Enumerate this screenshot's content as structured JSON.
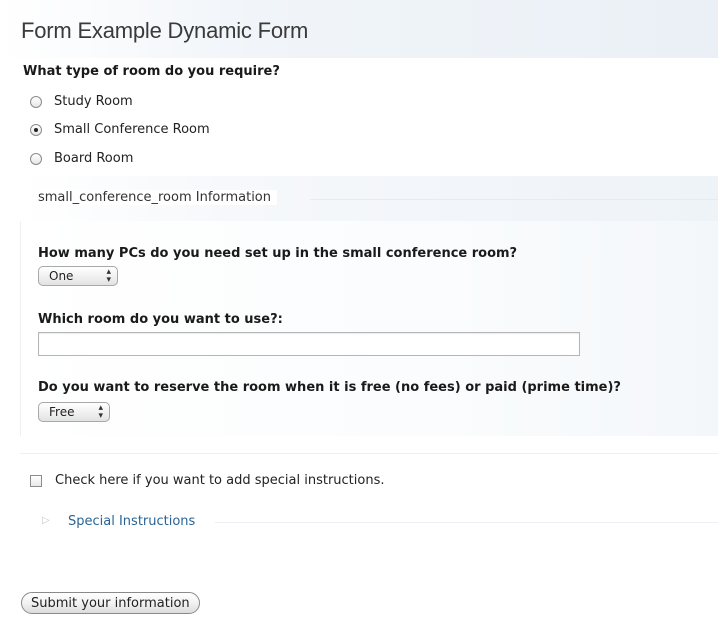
{
  "form": {
    "title": "Form Example Dynamic Form"
  },
  "room_type": {
    "question": "What type of room do you require?",
    "options": [
      {
        "label": "Study Room",
        "selected": false
      },
      {
        "label": "Small Conference Room",
        "selected": true
      },
      {
        "label": "Board Room",
        "selected": false
      }
    ]
  },
  "section": {
    "legend": "small_conference_room Information",
    "pcs": {
      "question": "How many PCs do you need set up in the small conference room?",
      "selected": "One"
    },
    "room": {
      "question": "Which room do you want to use?:",
      "value": ""
    },
    "reserve": {
      "question": "Do you want to reserve the room when it is free (no fees) or paid (prime time)?",
      "selected": "Free"
    }
  },
  "special": {
    "checkbox_label": "Check here if you want to add special instructions.",
    "checked": false,
    "link_label": "Special Instructions"
  },
  "submit": {
    "label": "Submit your information"
  },
  "icons": {
    "select_arrows": "up-down-arrows-icon",
    "disclosure": "triangle-right-icon"
  }
}
